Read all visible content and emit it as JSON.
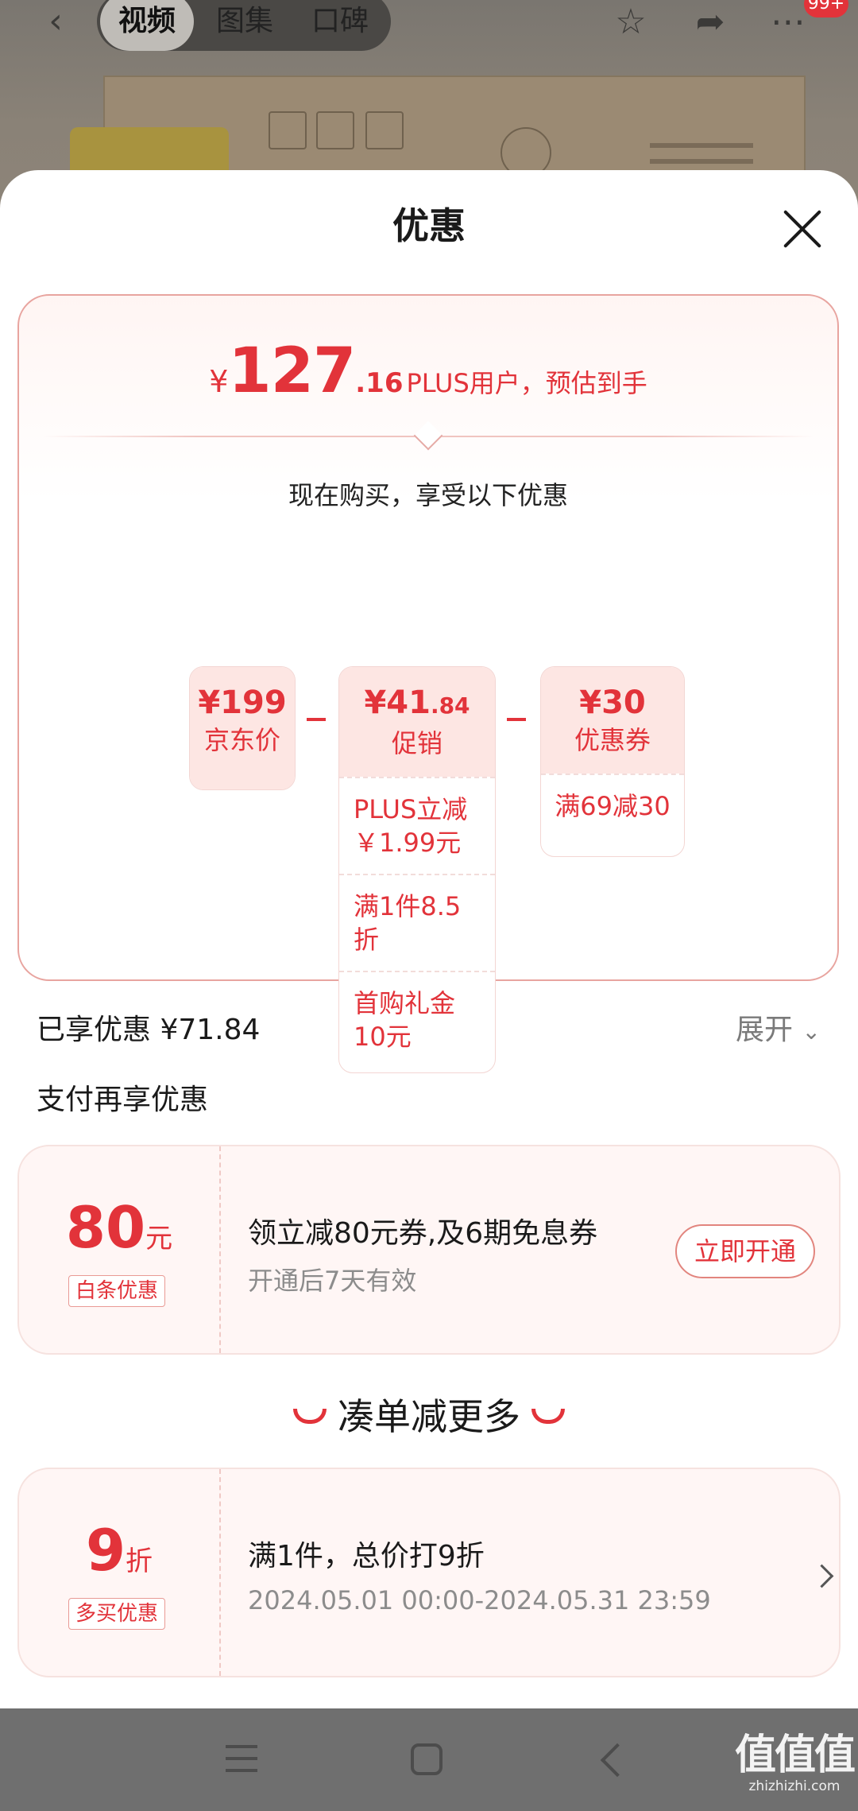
{
  "header": {
    "tabs": [
      "视频",
      "图集",
      "口碑"
    ],
    "badge": "99+"
  },
  "sheet": {
    "title": "优惠",
    "estimate": {
      "currency": "¥",
      "integer": "127",
      "decimal": ".16",
      "suffix": "PLUS用户，预估到手"
    },
    "buy_now_text": "现在购买，享受以下优惠",
    "breakdown": {
      "jd_price": {
        "amount": "¥199",
        "label": "京东价"
      },
      "promo": {
        "amount": "¥41",
        "amount_decimal": ".84",
        "label": "促销",
        "items": [
          "PLUS立减\n￥1.99元",
          "满1件8.5折",
          "首购礼金\n10元"
        ]
      },
      "coupon": {
        "amount": "¥30",
        "label": "优惠券",
        "items": [
          "满69减30"
        ]
      }
    },
    "enjoyed": "已享优惠 ¥71.84",
    "expand_label": "展开",
    "pay_more_title": "支付再享优惠",
    "baitiao": {
      "amount": "80",
      "unit": "元",
      "tag": "白条优惠",
      "title": "领立减80元券,及6期免息券",
      "subtitle": "开通后7天有效",
      "button": "立即开通"
    },
    "more_title": "凑单减更多",
    "multi_buy": {
      "amount": "9",
      "unit": "折",
      "tag": "多买优惠",
      "title": "满1件，总价打9折",
      "period": "2024.05.01 00:00-2024.05.31 23:59"
    }
  },
  "watermark": {
    "main": "值值值",
    "sub": "zhizhizhi.com"
  },
  "colors": {
    "accent": "#e2333a",
    "card_bg": "#fff6f5"
  }
}
